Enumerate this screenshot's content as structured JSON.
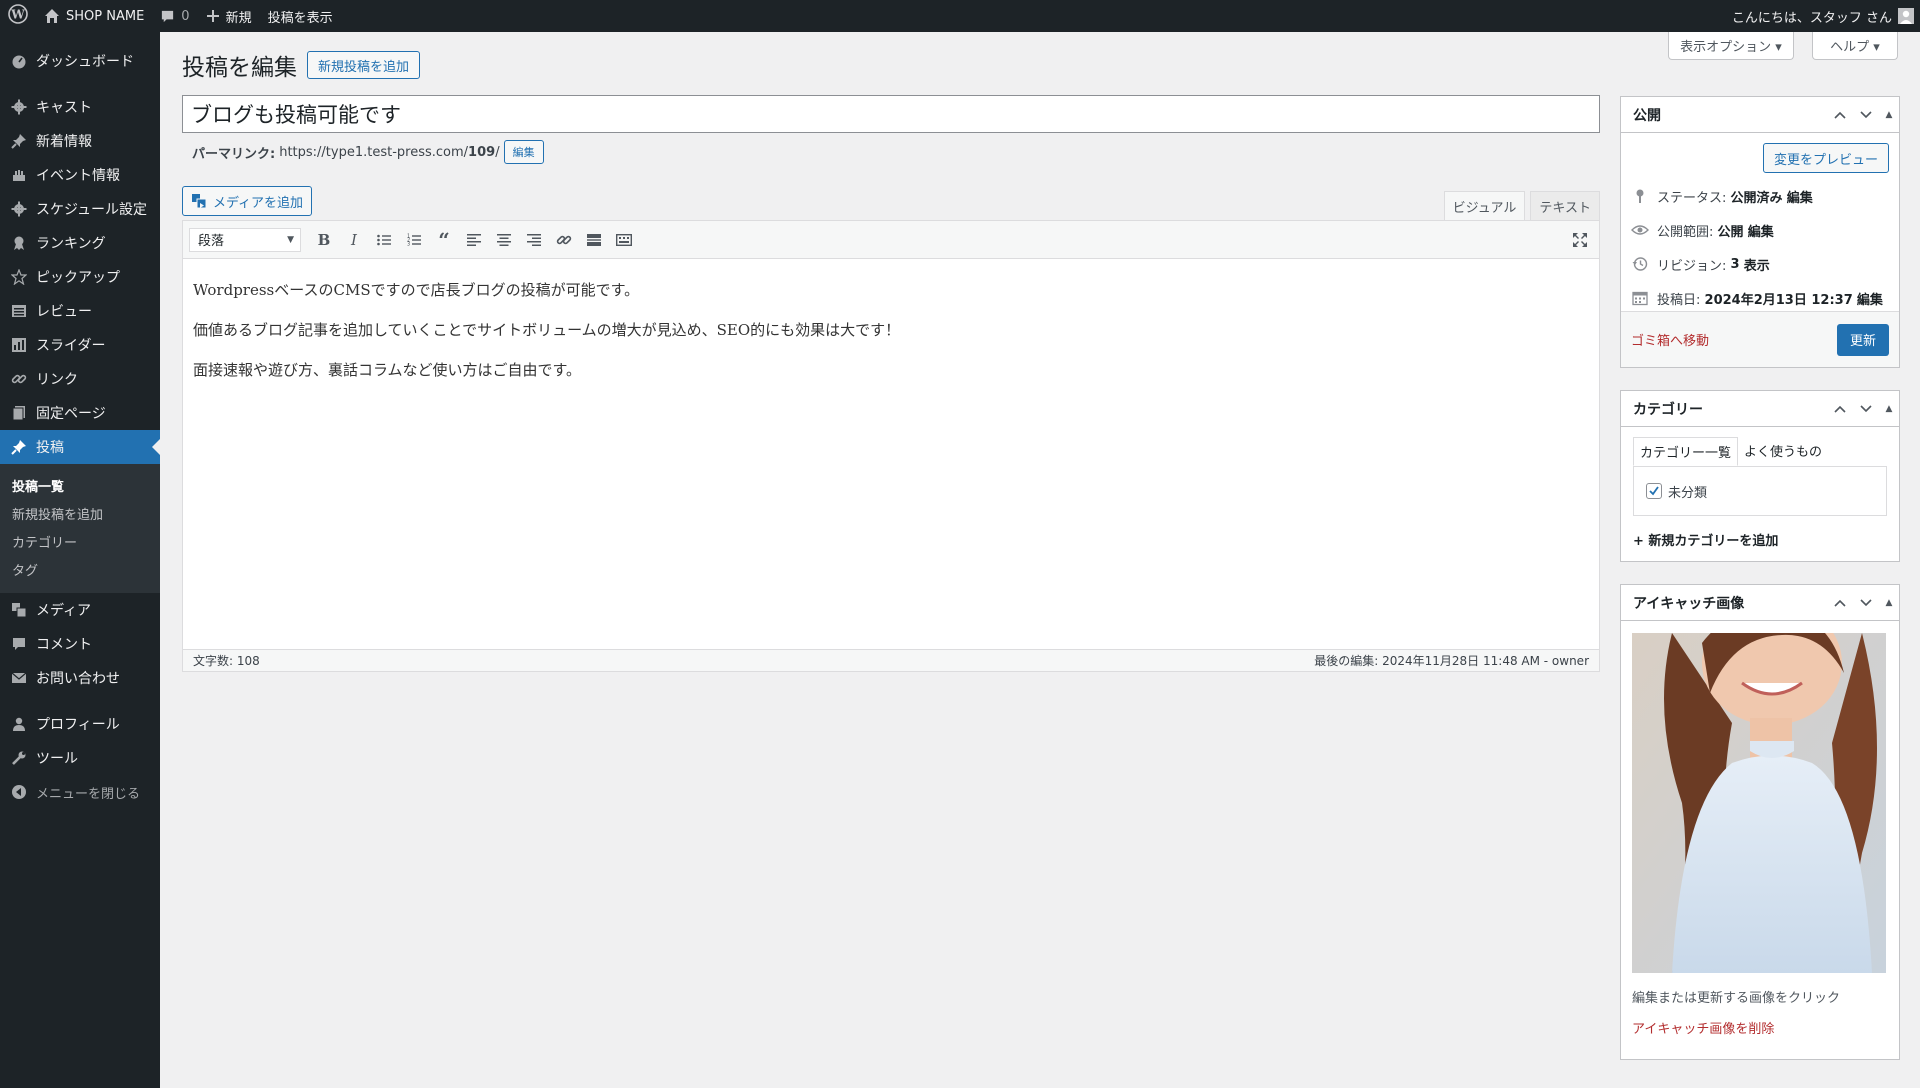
{
  "adminbar": {
    "site_name": "SHOP NAME",
    "comments_count": "0",
    "new_label": "新規",
    "view_post": "投稿を表示",
    "greeting": "こんにちは、スタッフ さん"
  },
  "sidebar": {
    "items": [
      {
        "label": "ダッシュボード"
      },
      {
        "label": "キャスト"
      },
      {
        "label": "新着情報"
      },
      {
        "label": "イベント情報"
      },
      {
        "label": "スケジュール設定"
      },
      {
        "label": "ランキング"
      },
      {
        "label": "ピックアップ"
      },
      {
        "label": "レビュー"
      },
      {
        "label": "スライダー"
      },
      {
        "label": "リンク"
      },
      {
        "label": "固定ページ"
      },
      {
        "label": "投稿"
      },
      {
        "label": "メディア"
      },
      {
        "label": "コメント"
      },
      {
        "label": "お問い合わせ"
      },
      {
        "label": "プロフィール"
      },
      {
        "label": "ツール"
      },
      {
        "label": "メニューを閉じる"
      }
    ],
    "submenu": [
      {
        "label": "投稿一覧"
      },
      {
        "label": "新規投稿を追加"
      },
      {
        "label": "カテゴリー"
      },
      {
        "label": "タグ"
      }
    ]
  },
  "screen_options": "表示オプション ▾",
  "help": "ヘルプ ▾",
  "page": {
    "title": "投稿を編集",
    "add_new": "新規投稿を追加",
    "post_title": "ブログも投稿可能です",
    "permalink_label": "パーマリンク:",
    "permalink_base": "https://type1.test-press.com/",
    "permalink_slug": "109",
    "permalink_tail": "/",
    "permalink_edit": "編集",
    "add_media": "メディアを追加"
  },
  "editor": {
    "tab_visual": "ビジュアル",
    "tab_text": "テキスト",
    "format": "段落",
    "paragraphs": [
      "WordpressベースのCMSですので店長ブログの投稿が可能です。",
      "価値あるブログ記事を追加していくことでサイトボリュームの増大が見込め、SEO的にも効果は大です！",
      "面接速報や遊び方、裏話コラムなど使い方はご自由です。"
    ],
    "word_count": "文字数: 108",
    "last_edited": "最後の編集: 2024年11月28日 11:48 AM - owner"
  },
  "publish": {
    "title": "公開",
    "preview": "変更をプレビュー",
    "status_label": "ステータス:",
    "status_value": "公開済み",
    "visibility_label": "公開範囲:",
    "visibility_value": "公開",
    "revisions_label": "リビジョン:",
    "revisions_value": "3",
    "revisions_link": "表示",
    "date_label": "投稿日:",
    "date_value": "2024年2月13日 12:37",
    "edit": "編集",
    "trash": "ゴミ箱へ移動",
    "update": "更新"
  },
  "categories": {
    "title": "カテゴリー",
    "tab_all": "カテゴリー一覧",
    "tab_popular": "よく使うもの",
    "items": [
      {
        "label": "未分類",
        "checked": true
      }
    ],
    "add_new": "+ 新規カテゴリーを追加"
  },
  "featured": {
    "title": "アイキャッチ画像",
    "hint": "編集または更新する画像をクリック",
    "remove": "アイキャッチ画像を削除"
  },
  "colors": {
    "accent": "#2271b1",
    "adminbar": "#1d2327",
    "danger": "#b32d2e"
  }
}
